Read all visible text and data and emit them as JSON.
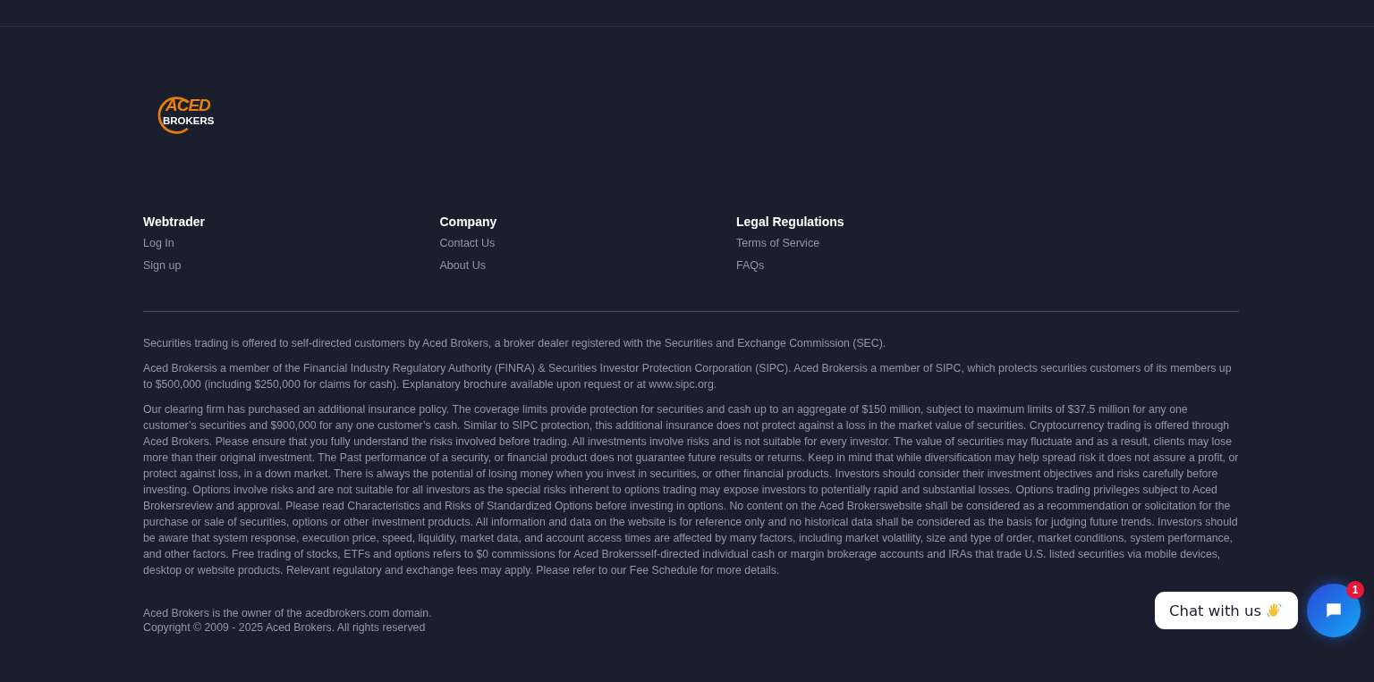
{
  "logo": {
    "top": "ACED",
    "bottom": "BROKERS"
  },
  "columns": [
    {
      "heading": "Webtrader",
      "links": [
        "Log In",
        "Sign up"
      ]
    },
    {
      "heading": "Company",
      "links": [
        "Contact Us",
        "About Us"
      ]
    },
    {
      "heading": "Legal Regulations",
      "links": [
        "Terms of Service",
        "FAQs"
      ]
    }
  ],
  "disclaimers": [
    "Securities trading is offered to self-directed customers by Aced Brokers, a broker dealer registered with the Securities and Exchange Commission (SEC).",
    "Aced Brokersis a member of the Financial Industry Regulatory Authority (FINRA) & Securities Investor Protection Corporation (SIPC). Aced Brokersis a member of SIPC, which protects securities customers of its members up to $500,000 (including $250,000 for claims for cash). Explanatory brochure available upon request or at www.sipc.org.",
    "Our clearing firm has purchased an additional insurance policy. The coverage limits provide protection for securities and cash up to an aggregate of $150 million, subject to maximum limits of $37.5 million for any one customer’s securities and $900,000 for any one customer’s cash. Similar to SIPC protection, this additional insurance does not protect against a loss in the market value of securities. Cryptocurrency trading is offered through Aced Brokers. Please ensure that you fully understand the risks involved before trading. All investments involve risks and is not suitable for every investor. The value of securities may fluctuate and as a result, clients may lose more than their original investment. The Past performance of a security, or financial product does not guarantee future results or returns. Keep in mind that while diversification may help spread risk it does not assure a profit, or protect against loss, in a down market. There is always the potential of losing money when you invest in securities, or other financial products. Investors should consider their investment objectives and risks carefully before investing. Options involve risks and are not suitable for all investors as the special risks inherent to options trading may expose investors to potentially rapid and substantial losses. Options trading privileges subject to Aced Brokersreview and approval. Please read Characteristics and Risks of Standardized Options before investing in options. No content on the Aced Brokerswebsite shall be considered as a recommendation or solicitation for the purchase or sale of securities, options or other investment products. All information and data on the website is for reference only and no historical data shall be considered as the basis for judging future trends. Investors should be aware that system response, execution price, speed, liquidity, market data, and account access times are affected by many factors, including market volatility, size and type of order, market conditions, system performance, and other factors. Free trading of stocks, ETFs and options refers to $0 commissions for Aced Brokersself-directed individual cash or margin brokerage accounts and IRAs that trade U.S. listed securities via mobile devices, desktop or website products. Relevant regulatory and exchange fees may apply. Please refer to our Fee Schedule for more details."
  ],
  "ownership": [
    "Aced Brokers is the owner of the acedbrokers.com domain.",
    "Copyright © 2009 - 2025 Aced Brokers. All rights reserved"
  ],
  "chat": {
    "label": "Chat with us",
    "badge": "1"
  }
}
